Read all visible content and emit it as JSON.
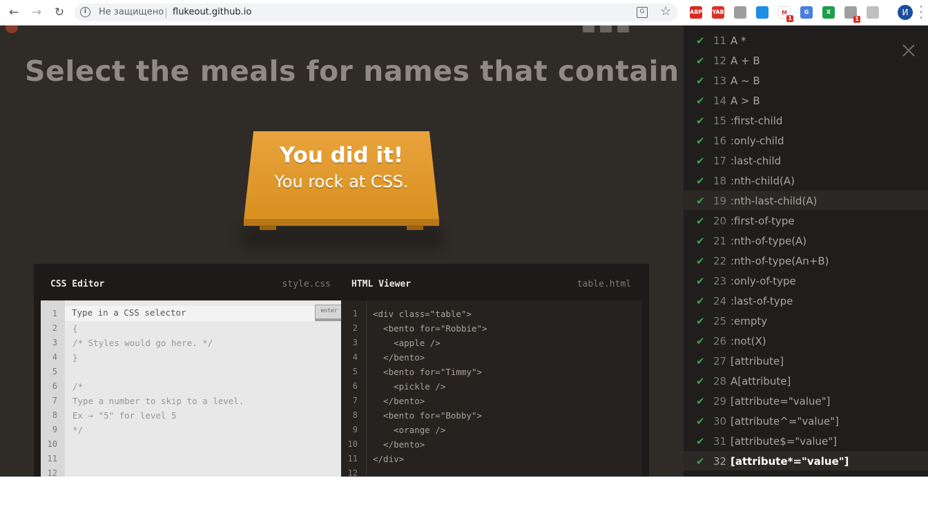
{
  "browser": {
    "security_label": "Не защищено",
    "url": "flukeout.github.io",
    "back_icon": "arrow-left-icon",
    "forward_icon": "arrow-right-icon",
    "reload_icon": "reload-icon",
    "profile_initial": "И",
    "extensions": [
      {
        "name": "adblock-icon",
        "label": "ABP",
        "color": "#d82a20"
      },
      {
        "name": "yandex-icon",
        "label": "YAB",
        "color": "#d8322a"
      },
      {
        "name": "paw-icon",
        "label": "",
        "color": "#9e9e9e"
      },
      {
        "name": "window-icon",
        "label": "",
        "color": "#1f8ce6"
      },
      {
        "name": "gmail-icon",
        "label": "M",
        "color": "#ffffff",
        "badge": "1"
      },
      {
        "name": "translate-icon",
        "label": "G",
        "color": "#4a7de0"
      },
      {
        "name": "excel-icon",
        "label": "X",
        "color": "#1e9f4a"
      },
      {
        "name": "puzzle-icon",
        "label": "",
        "color": "#a0a0a0",
        "badge": "1"
      },
      {
        "name": "pdf-icon",
        "label": "",
        "color": "#c0c0c0"
      }
    ]
  },
  "game": {
    "instruction": "Select the meals for names that contain 'obb'",
    "win_line1": "You did it!",
    "win_line2": "You rock at CSS.",
    "css_editor": {
      "title": "CSS Editor",
      "file": "style.css",
      "placeholder": "Type in a CSS selector",
      "enter_label": "enter",
      "line_numbers": [
        "1",
        "2",
        "3",
        "4",
        "5",
        "6",
        "7",
        "8",
        "9",
        "10",
        "11",
        "12"
      ],
      "lines": [
        "",
        "{",
        "/* Styles would go here. */",
        "}",
        "",
        "/*",
        "Type a number to skip to a level.",
        "Ex → \"5\" for level 5",
        "*/",
        "",
        "",
        ""
      ]
    },
    "html_viewer": {
      "title": "HTML Viewer",
      "file": "table.html",
      "line_numbers": [
        "1",
        "2",
        "3",
        "4",
        "5",
        "6",
        "7",
        "8",
        "9",
        "10",
        "11",
        "12"
      ],
      "lines": [
        "<div class=\"table\">",
        "  <bento for=\"Robbie\">",
        "    <apple />",
        "  </bento>",
        "  <bento for=\"Timmy\">",
        "    <pickle />",
        "  </bento>",
        "  <bento for=\"Bobby\">",
        "    <orange />",
        "  </bento>",
        "</div>",
        ""
      ]
    }
  },
  "levels": [
    {
      "num": "11",
      "selector": "A *"
    },
    {
      "num": "12",
      "selector": "A + B"
    },
    {
      "num": "13",
      "selector": "A ~ B"
    },
    {
      "num": "14",
      "selector": "A > B"
    },
    {
      "num": "15",
      "selector": ":first-child"
    },
    {
      "num": "16",
      "selector": ":only-child"
    },
    {
      "num": "17",
      "selector": ":last-child"
    },
    {
      "num": "18",
      "selector": ":nth-child(A)"
    },
    {
      "num": "19",
      "selector": ":nth-last-child(A)",
      "highlight": true
    },
    {
      "num": "20",
      "selector": ":first-of-type"
    },
    {
      "num": "21",
      "selector": ":nth-of-type(A)"
    },
    {
      "num": "22",
      "selector": ":nth-of-type(An+B)"
    },
    {
      "num": "23",
      "selector": ":only-of-type"
    },
    {
      "num": "24",
      "selector": ":last-of-type"
    },
    {
      "num": "25",
      "selector": ":empty"
    },
    {
      "num": "26",
      "selector": ":not(X)"
    },
    {
      "num": "27",
      "selector": "[attribute]"
    },
    {
      "num": "28",
      "selector": "A[attribute]"
    },
    {
      "num": "29",
      "selector": "[attribute=\"value\"]"
    },
    {
      "num": "30",
      "selector": "[attribute^=\"value\"]"
    },
    {
      "num": "31",
      "selector": "[attribute$=\"value\"]"
    },
    {
      "num": "32",
      "selector": "[attribute*=\"value\"]",
      "current": true
    }
  ],
  "colors": {
    "check": "#3ea24a",
    "table": "#e9a33c"
  }
}
